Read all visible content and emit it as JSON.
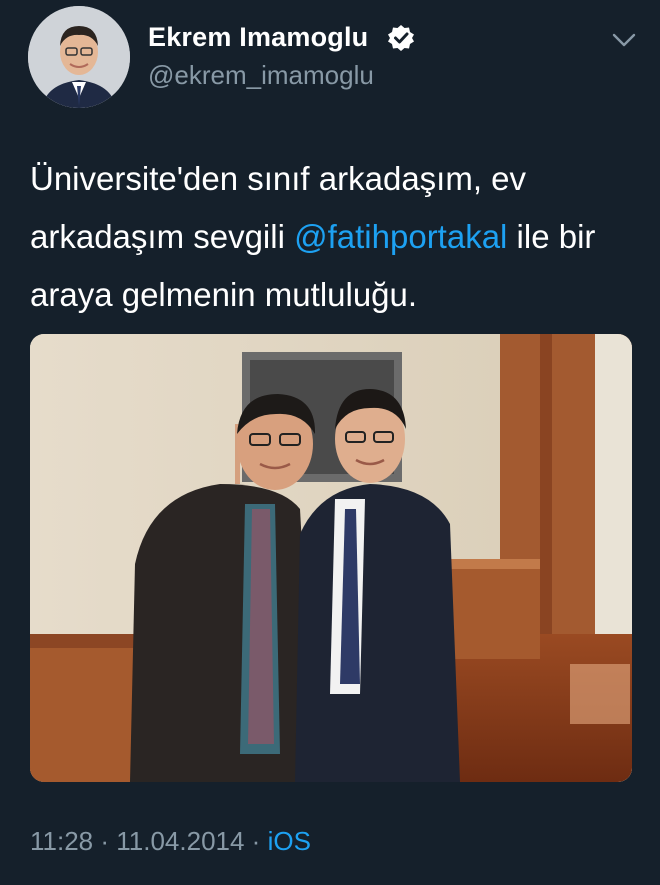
{
  "tweet": {
    "author": {
      "display_name": "Ekrem Imamoglu",
      "handle": "@ekrem_imamoglu",
      "verified": true
    },
    "text": {
      "before_mention": "Üniversite'den sınıf arkadaşım, ev arkadaşım sevgili ",
      "mention": "@fatihportakal",
      "after_mention": " ile bir araya gelmenin mutluluğu."
    },
    "meta": {
      "time": "11:28",
      "separator1": " · ",
      "date": "11.04.2014",
      "separator2": " · ",
      "app": "iOS"
    },
    "icons": {
      "verified": "verified-badge-icon",
      "menu": "chevron-down-icon"
    },
    "colors": {
      "background": "#15202b",
      "link": "#1da1f2",
      "secondary_text": "#8899a6"
    }
  }
}
